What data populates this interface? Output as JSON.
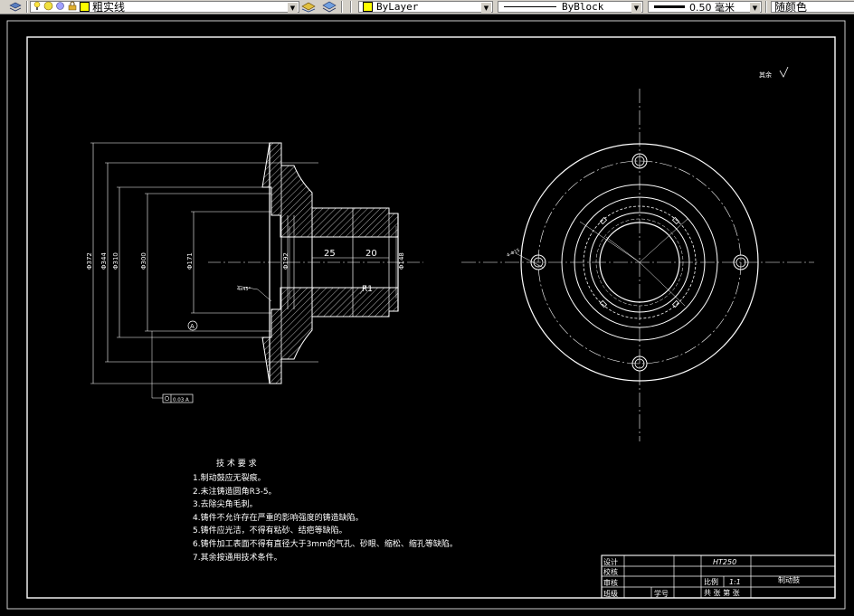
{
  "toolbar": {
    "linetype_name": "粗实线",
    "color_value": "ByLayer",
    "linetype_value": "ByBlock",
    "lineweight_value": "0.50 毫米",
    "plotstyle_value": "随颜色"
  },
  "drawing": {
    "surface_note": "其余",
    "datum_label": "A",
    "feature_frame": "0.03 A",
    "dims": {
      "d1": "Φ372",
      "d2": "Φ344",
      "d3": "Φ310",
      "d4": "Φ300",
      "d5": "Φ171",
      "d6": "Φ192",
      "d7": "Φ148",
      "len1": "25",
      "len2": "20",
      "radius": "R1",
      "chamfer": "4x45°",
      "hole_label": "4-Φ15"
    },
    "tech_req": {
      "title": "技 术 要 求",
      "items": [
        "1.制动鼓应无裂痕。",
        "2.未注铸造圆角R3-5。",
        "3.去除尖角毛刺。",
        "4.铸件不允许存在严重的影响强度的铸造缺陷。",
        "5.铸件应光洁，不得有粘砂、结疤等缺陷。",
        "6.铸件加工表面不得有直径大于3mm的气孔、砂眼、缩松、缩孔等缺陷。",
        "7.其余按通用技术条件。"
      ]
    },
    "title_block": {
      "material": "HT250",
      "scale_label": "比例",
      "scale_value": "1:1",
      "part_name": "制动鼓",
      "sheets": "共 张 第 张",
      "roles": [
        "设计",
        "校核",
        "审核",
        "班级"
      ],
      "student_no_label": "学号"
    }
  },
  "colors": {
    "background": "#000000",
    "line": "#ffffff",
    "toolbar": "#d4d0c8",
    "color_swatch": "#ffff00"
  }
}
